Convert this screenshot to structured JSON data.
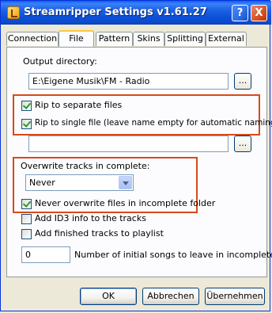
{
  "window": {
    "title": "Streamripper Settings v1.61.27",
    "icon": "streamripper-app-icon"
  },
  "titlebar_buttons": {
    "help_label": "?",
    "close_label": "X"
  },
  "tabs": [
    {
      "label": "Connection"
    },
    {
      "label": "File",
      "active": true
    },
    {
      "label": "Pattern"
    },
    {
      "label": "Skins"
    },
    {
      "label": "Splitting"
    },
    {
      "label": "External"
    }
  ],
  "file": {
    "output_dir_label": "Output directory:",
    "output_dir_value": "E:\\Eigene Musik\\FM - Radio",
    "browse_label": "...",
    "rip_separate_label": "Rip to separate files",
    "rip_separate_checked": true,
    "rip_single_label": "Rip to single file (leave name empty for automatic naming):",
    "rip_single_checked": true,
    "single_file_value": "",
    "overwrite_label": "Overwrite tracks in complete:",
    "overwrite_value": "Never",
    "never_overwrite_incomplete_label": "Never overwrite files in incomplete folder",
    "never_overwrite_incomplete_checked": true,
    "add_id3_label": "Add ID3 info to the tracks",
    "add_id3_checked": false,
    "add_playlist_label": "Add finished tracks to playlist",
    "add_playlist_checked": false,
    "initial_songs_value": "0",
    "initial_songs_label": "Number of initial songs to leave in incomplete"
  },
  "buttons": {
    "ok": "OK",
    "cancel": "Abbrechen",
    "apply": "Übernehmen"
  },
  "colors": {
    "highlight": "#d64a1a",
    "titlebar": "#0b49cc",
    "checkmark": "#21a121"
  }
}
